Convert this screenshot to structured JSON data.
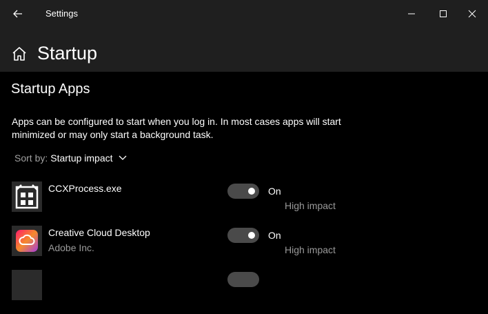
{
  "window": {
    "title": "Settings",
    "back_icon": "arrow-left-icon",
    "controls": [
      "minimize-icon",
      "maximize-icon",
      "close-icon"
    ]
  },
  "header": {
    "icon": "home-icon",
    "title": "Startup"
  },
  "section": {
    "title": "Startup Apps",
    "description": "Apps can be configured to start when you log in. In most cases apps will start minimized or may only start a background task."
  },
  "sort": {
    "label": "Sort by:",
    "value": "Startup impact"
  },
  "apps": [
    {
      "name": "CCXProcess.exe",
      "publisher": "",
      "state": "On",
      "impact": "High impact",
      "enabled": true,
      "icon": "generic-app-icon"
    },
    {
      "name": "Creative Cloud Desktop",
      "publisher": "Adobe Inc.",
      "state": "On",
      "impact": "High impact",
      "enabled": true,
      "icon": "creative-cloud-icon"
    }
  ],
  "colors": {
    "titlebar_bg": "#1f1f1f",
    "page_bg": "#000000",
    "toggle_bg": "#4a4a4a",
    "secondary_text": "#9a9a9a",
    "cc_gradient": [
      "#ff1b6b",
      "#f58b2d",
      "#a63be0"
    ]
  }
}
